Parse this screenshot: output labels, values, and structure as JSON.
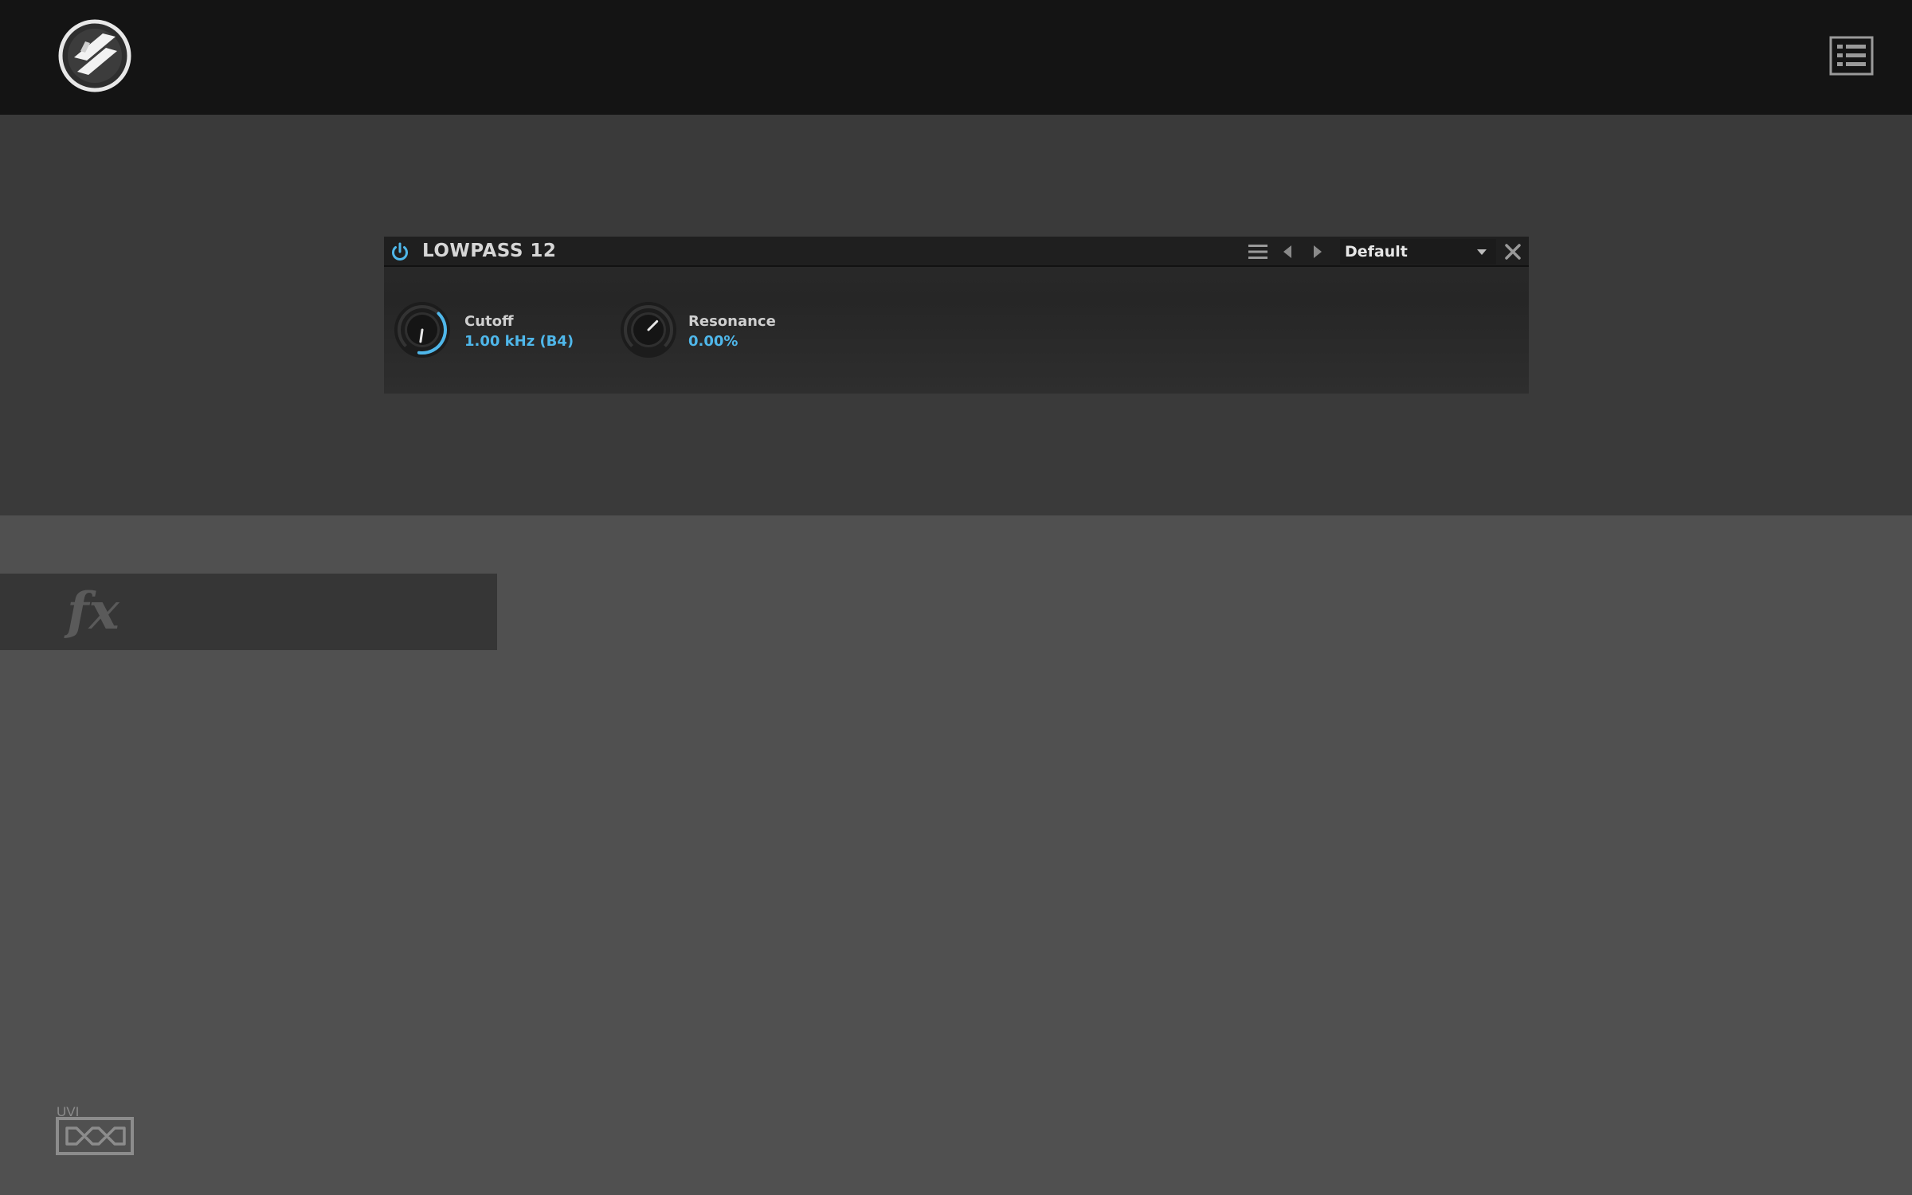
{
  "header": {
    "logo_icon": "falcon-logo-icon",
    "menu_icon": "list-menu-icon"
  },
  "plugin": {
    "title": "LOWPASS 12",
    "enabled": true,
    "preset": "Default",
    "accent_color": "#4fb7ea",
    "params": [
      {
        "label": "Cutoff",
        "value": "1.00 kHz (B4)",
        "knob_position": 0.53
      },
      {
        "label": "Resonance",
        "value": "0.00%",
        "knob_position": 0.0
      }
    ]
  },
  "fx": {
    "label": "fx"
  },
  "footer": {
    "brand": "UVI"
  }
}
